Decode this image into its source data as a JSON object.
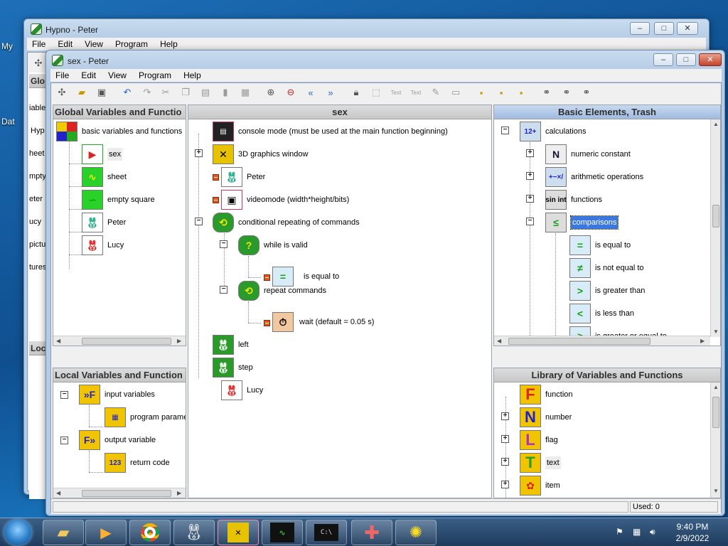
{
  "desktop": {
    "labels": [
      "My",
      "Dat"
    ]
  },
  "back_window": {
    "title": "Hypno - Peter",
    "menu": [
      "File",
      "Edit",
      "View",
      "Program",
      "Help"
    ],
    "side_fragments": [
      "Glo",
      "iable",
      "Hyp",
      "heet",
      "mpty",
      "eter",
      "ucy",
      "pictu",
      "tures",
      "Loc"
    ]
  },
  "front_window": {
    "title": "sex - Peter",
    "menu": [
      "File",
      "Edit",
      "View",
      "Program",
      "Help"
    ],
    "toolbar_icons": [
      "tree-icon",
      "open-folder-icon",
      "save-icon",
      "undo-icon",
      "redo-icon",
      "cut-icon",
      "copy-icon",
      "paste-icon",
      "delete-icon",
      "grid-icon",
      "zoom-in-icon",
      "zoom-out-icon",
      "double-left-icon",
      "double-right-icon",
      "lock-icon",
      "select-icon",
      "text-icon",
      "text-field-icon",
      "edit-icon",
      "image-icon",
      "lock-open-icon",
      "lock-small-icon",
      "lock-yellow-icon",
      "binoculars-icon",
      "find-icon",
      "find-next-icon"
    ]
  },
  "panels": {
    "global": {
      "title": "Global Variables and Functio",
      "items": [
        {
          "label": "basic variables and functions",
          "icon": "color-grid-icon"
        },
        {
          "label": "sex",
          "icon": "rabbit-arrow-icon"
        },
        {
          "label": "sheet",
          "icon": "sheet-icon"
        },
        {
          "label": "empty square",
          "icon": "empty-square-icon"
        },
        {
          "label": "Peter",
          "icon": "rabbit-peter-icon"
        },
        {
          "label": "Lucy",
          "icon": "rabbit-lucy-icon"
        }
      ]
    },
    "local": {
      "title": "Local Variables and Function",
      "items": [
        {
          "label": "input variables",
          "icon": "input-arrow-icon"
        },
        {
          "label": "program parame",
          "icon": "param-icon"
        },
        {
          "label": "output variable",
          "icon": "output-arrow-icon"
        },
        {
          "label": "return code",
          "icon": "return-code-icon"
        }
      ]
    },
    "center": {
      "title": "sex",
      "items": [
        {
          "label": "console mode (must be used at the main function beginning)",
          "icon": "console-icon"
        },
        {
          "label": "3D graphics window",
          "icon": "3d-window-icon"
        },
        {
          "label": "Peter",
          "icon": "rabbit-peter-icon"
        },
        {
          "label": "videomode (width*height/bits)",
          "icon": "videomode-icon"
        },
        {
          "label": "conditional repeating of commands",
          "icon": "loop-icon"
        },
        {
          "label": "while is valid",
          "icon": "question-icon"
        },
        {
          "label": "is equal to",
          "icon": "equal-icon"
        },
        {
          "label": "repeat commands",
          "icon": "repeat-icon"
        },
        {
          "label": "wait (default = 0.05 s)",
          "icon": "stopwatch-icon"
        },
        {
          "label": "left",
          "icon": "rabbit-left-icon"
        },
        {
          "label": "step",
          "icon": "rabbit-step-icon"
        },
        {
          "label": "Lucy",
          "icon": "rabbit-lucy-icon"
        }
      ]
    },
    "basic": {
      "title": "Basic Elements, Trash",
      "items": [
        {
          "label": "calculations",
          "icon": "calculations-icon"
        },
        {
          "label": "numeric constant",
          "icon": "n-icon",
          "glyph": "N"
        },
        {
          "label": "arithmetic operations",
          "icon": "arithmetic-icon",
          "glyph": "+−×/"
        },
        {
          "label": "functions",
          "icon": "sin-int-icon",
          "glyph": "sin int"
        },
        {
          "label": "comparisons",
          "icon": "comparisons-icon"
        },
        {
          "label": "is equal to",
          "icon": "equal-icon",
          "glyph": "="
        },
        {
          "label": "is not equal to",
          "icon": "not-equal-icon",
          "glyph": "≠"
        },
        {
          "label": "is greater than",
          "icon": "greater-icon",
          "glyph": ">"
        },
        {
          "label": "is less than",
          "icon": "less-icon",
          "glyph": "<"
        },
        {
          "label": "is greater or equal to",
          "icon": "greater-equal-icon",
          "glyph": "≥"
        }
      ]
    },
    "library": {
      "title": "Library of Variables and Functions",
      "items": [
        {
          "label": "function",
          "icon": "f-icon",
          "glyph": "F",
          "color": "#f0c400"
        },
        {
          "label": "number",
          "icon": "n-icon",
          "glyph": "N",
          "color": "#f0c400"
        },
        {
          "label": "flag",
          "icon": "l-icon",
          "glyph": "L",
          "color": "#f0c400"
        },
        {
          "label": "text",
          "icon": "t-icon",
          "glyph": "T",
          "color": "#f0c400"
        },
        {
          "label": "item",
          "icon": "item-icon",
          "glyph": "✿",
          "color": "#f0c400"
        }
      ]
    }
  },
  "status": {
    "used": "Used: 0"
  },
  "taskbar": {
    "apps": [
      "folder-icon",
      "media-player-icon",
      "chrome-icon",
      "hypno-rabbit-icon",
      "3d-icon",
      "oscilloscope-icon",
      "cmd-icon",
      "cross-icon",
      "sphere-icon"
    ],
    "time": "9:40 PM",
    "date": "2/9/2022"
  }
}
